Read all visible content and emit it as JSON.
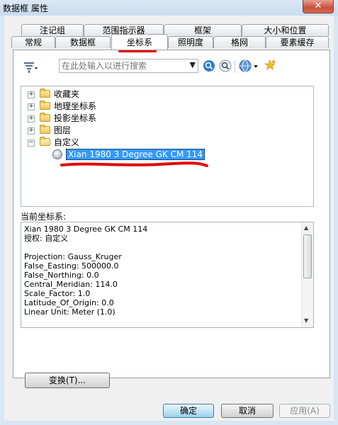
{
  "window": {
    "title": "数据框 属性",
    "close_glyph": "✕"
  },
  "tabs_back": [
    {
      "label": "注记组"
    },
    {
      "label": "范围指示器"
    },
    {
      "label": "框架"
    },
    {
      "label": "大小和位置"
    }
  ],
  "tabs_front": [
    {
      "label": "常规"
    },
    {
      "label": "数据框"
    },
    {
      "label": "坐标系",
      "active": true
    },
    {
      "label": "照明度"
    },
    {
      "label": "格网"
    },
    {
      "label": "要素缓存"
    }
  ],
  "toolbar": {
    "search_placeholder": "在此处输入以进行搜索",
    "icons": [
      "filter-icon",
      "search-icon",
      "clear-search-icon",
      "globe-icon",
      "add-favorite-icon"
    ]
  },
  "tree": [
    {
      "label": "收藏夹",
      "expander": "+",
      "kind": "folder-star"
    },
    {
      "label": "地理坐标系",
      "expander": "+",
      "kind": "folder"
    },
    {
      "label": "投影坐标系",
      "expander": "+",
      "kind": "folder"
    },
    {
      "label": "图层",
      "expander": "+",
      "kind": "folder"
    },
    {
      "label": "自定义",
      "expander": "−",
      "kind": "folder-open"
    }
  ],
  "selected_item": "Xian 1980 3 Degree GK CM 114",
  "current_crs_label": "当前坐标系:",
  "current_crs_text": [
    "Xian 1980 3 Degree GK CM 114",
    "授权: 自定义",
    "",
    "Projection: Gauss_Kruger",
    "False_Easting: 500000.0",
    "False_Northing: 0.0",
    "Central_Meridian: 114.0",
    "Scale_Factor: 1.0",
    "Latitude_Of_Origin: 0.0",
    "Linear Unit: Meter (1.0)"
  ],
  "buttons": {
    "transform": "变换(T)...",
    "ok": "确定",
    "cancel": "取消",
    "apply": "应用(A)"
  },
  "colors": {
    "annotation": "#e30000",
    "selection": "#3399ff"
  }
}
